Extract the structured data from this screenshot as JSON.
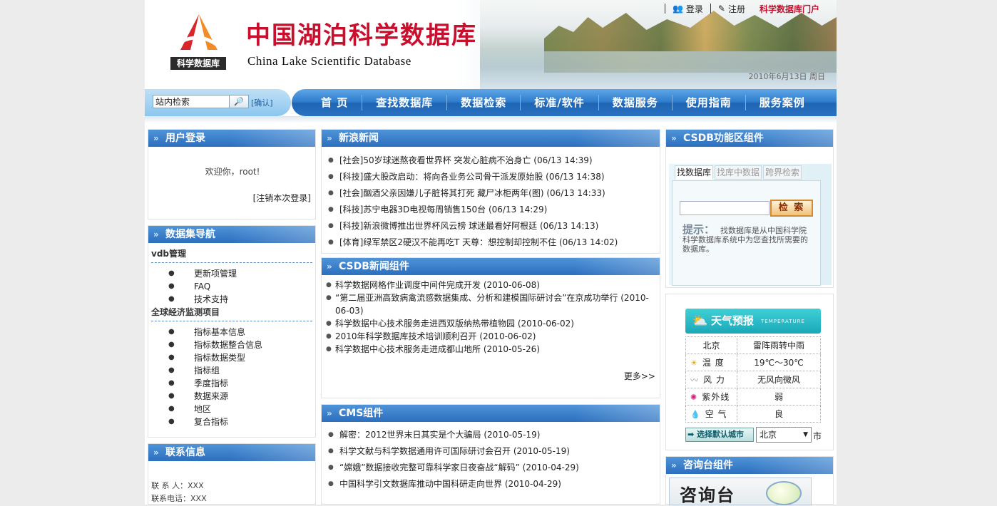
{
  "header": {
    "logo_text": "科学数据库",
    "title": "中国湖泊科学数据库",
    "subtitle": "China Lake Scientific Database",
    "login": "登录",
    "register": "注册",
    "portal": "科学数据库门户",
    "date": "2010年6月13日  周日"
  },
  "search": {
    "value": "站内检索",
    "go_label": "🔎",
    "confirm": "[确认]"
  },
  "nav": [
    "首 页",
    "查找数据库",
    "数据检索",
    "标准/软件",
    "数据服务",
    "使用指南",
    "服务案例"
  ],
  "login_panel": {
    "title": "用户登录",
    "welcome": "欢迎你，root!",
    "logout": "[注销本次登录]"
  },
  "dataset_nav": {
    "title": "数据集导航",
    "groups": [
      {
        "name": "vdb管理",
        "items": [
          "更新项管理",
          "FAQ",
          "技术支持"
        ]
      },
      {
        "name": "全球经济监测项目",
        "items": [
          "指标基本信息",
          "指标数据整合信息",
          "指标数据类型",
          "指标组",
          "季度指标",
          "数据来源",
          "地区",
          "复合指标"
        ]
      }
    ]
  },
  "contact": {
    "title": "联系信息",
    "person": "联 系 人：XXX",
    "phone": "联系电话：XXX"
  },
  "sina": {
    "title": "新浪新闻",
    "items": [
      "[社会]50岁球迷熬夜看世界杯 突发心脏病不治身亡 (06/13 14:39)",
      "[科技]盛大股改启动：将向各业务公司骨干派发原始股 (06/13 14:38)",
      "[社会]酗酒父亲因嫌儿子脏将其打死 藏尸冰柜两年(图) (06/13 14:33)",
      "[科技]苏宁电器3D电视每周销售150台 (06/13 14:29)",
      "[科技]新浪微博推出世界杯风云榜 球迷最看好阿根廷 (06/13 14:13)",
      "[体育]绿军禁区2硬汉不能再吃T 天尊：想控制却控制不住 (06/13 14:02)"
    ]
  },
  "csdb_news": {
    "title": "CSDB新闻组件",
    "items": [
      "科学数据网格作业调度中间件完成开发 (2010-06-08)",
      "“第二届亚洲高致病禽流感数据集成、分析和建模国际研讨会”在京成功举行 (2010-06-03)",
      "科学数据中心技术服务走进西双版纳热带植物园 (2010-06-02)",
      "2010年科学数据库技术培训顺利召开 (2010-06-02)",
      "科学数据中心技术服务走进成都山地所 (2010-05-26)"
    ],
    "more": "更多>>"
  },
  "cms": {
    "title": "CMS组件",
    "items": [
      "解密：2012世界末日其实是个大骗局 (2010-05-19)",
      "科学文献与科学数据通用许可国际研讨会召开 (2010-05-19)",
      "“嫦娥”数据接收完整可靠科学家日夜奋战“解码” (2010-04-29)",
      "中国科学引文数据库推动中国科研走向世界 (2010-04-29)"
    ]
  },
  "func": {
    "title": "CSDB功能区组件",
    "tabs": [
      "找数据库",
      "找库中数据",
      "跨界检索"
    ],
    "button": "检 索",
    "tip_label": "提示：",
    "tip": "找数据库是从中国科学院科学数据库系统中为您查找所需要的数据库。"
  },
  "weather": {
    "title": "天气预报",
    "title_en": "TEMPERATURE",
    "city": "北京",
    "condition": "雷阵雨转中雨",
    "rows": [
      {
        "icon": "☀",
        "key": "温  度",
        "val": "19℃～30℃"
      },
      {
        "icon": "〰",
        "key": "风  力",
        "val": "无风向微风"
      },
      {
        "icon": "✺",
        "key": "紫外线",
        "val": "弱"
      },
      {
        "icon": "💧",
        "key": "空  气",
        "val": "良"
      }
    ],
    "city_button": "选择默认城市",
    "selected_city": "北京",
    "suffix": "市"
  },
  "consult": {
    "title": "咨询台组件",
    "image_text": "咨询台"
  }
}
